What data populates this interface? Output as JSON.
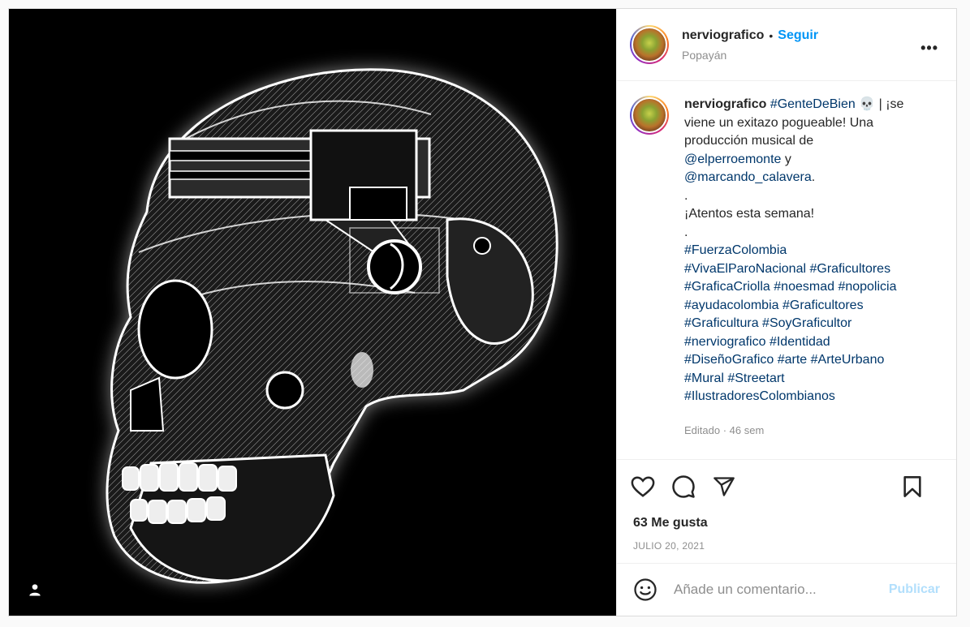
{
  "header": {
    "username": "nerviografico",
    "separator": "•",
    "follow_label": "Seguir",
    "location": "Popayán",
    "more_label": "•••"
  },
  "caption": {
    "username": "nerviografico",
    "hashtag_1": "#GenteDeBien",
    "emoji": "💀",
    "text_1": " | ¡se viene un exitazo pogueable! Una producción musical de",
    "mention_1": "@elperroemonte",
    "text_2": " y",
    "mention_2": "@marcando_calavera",
    "text_3": ".",
    "dot_1": ".",
    "line_atentos": "¡Atentos esta semana!",
    "dot_2": ".",
    "tags": [
      [
        "#FuerzaColombia"
      ],
      [
        "#VivaElParoNacional",
        "#Graficultores"
      ],
      [
        "#GraficaCriolla",
        "#noesmad",
        "#nopolicia"
      ],
      [
        "#ayudacolombia",
        "#Graficultores"
      ],
      [
        "#Graficultura",
        "#SoyGraficultor"
      ],
      [
        "#nerviografico",
        "#Identidad"
      ],
      [
        "#DiseñoGrafico",
        "#arte",
        "#ArteUrbano"
      ],
      [
        "#Mural",
        "#Streetart"
      ],
      [
        "#IlustradoresColombianos"
      ]
    ],
    "meta": "Editado · 46 sem"
  },
  "engagement": {
    "likes": "63 Me gusta",
    "date": "JULIO 20, 2021"
  },
  "comment_box": {
    "placeholder": "Añade un comentario...",
    "publish_label": "Publicar"
  },
  "icons": {
    "like": "heart-icon",
    "comment": "comment-icon",
    "share": "share-icon",
    "save": "bookmark-icon",
    "emoji": "emoji-icon",
    "user_tag": "user-tag-icon"
  },
  "colors": {
    "accent": "#0095f6",
    "hashtag": "#00376b",
    "muted": "#8e8e8e",
    "publish_disabled": "#b2dffc"
  }
}
